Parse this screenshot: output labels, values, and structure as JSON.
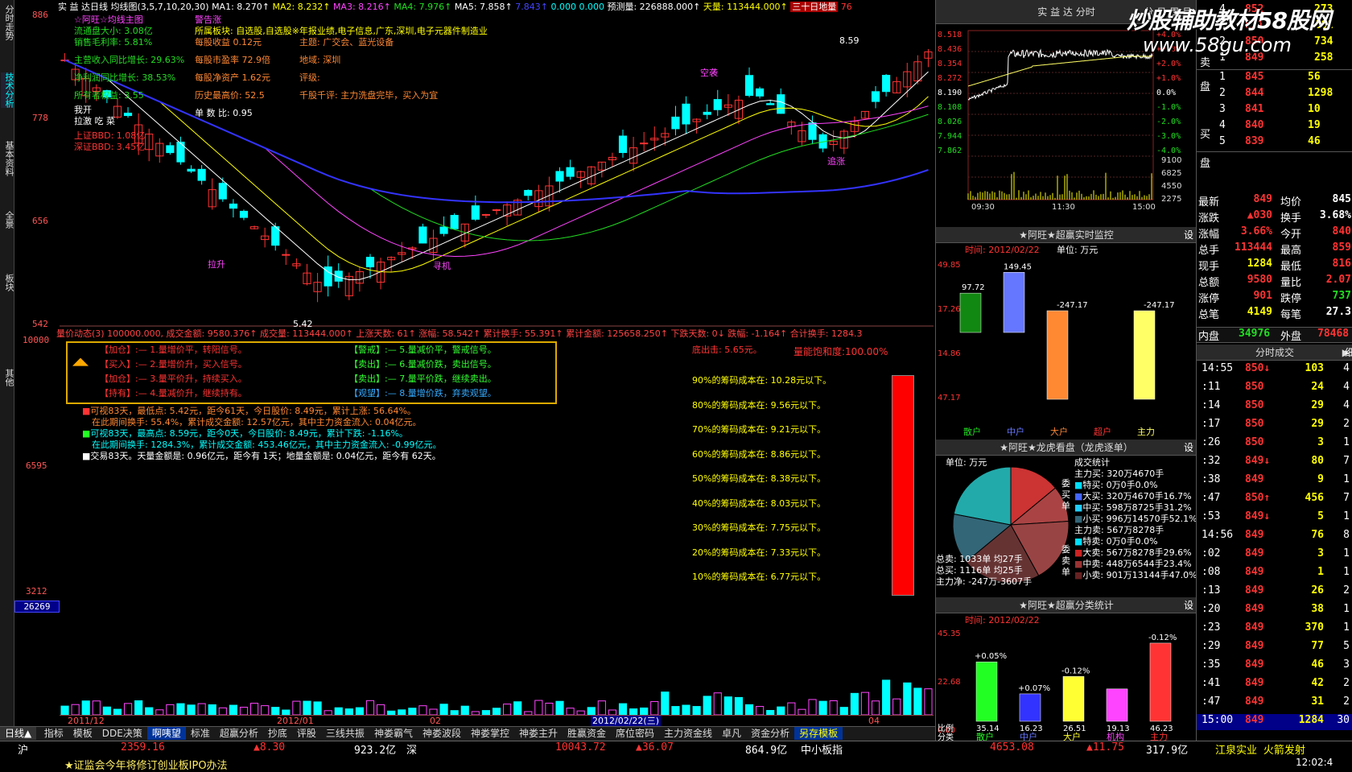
{
  "left_tabs": [
    "分时走势",
    "技术分析",
    "基本资料",
    "全景",
    "板块",
    "其他"
  ],
  "header": {
    "title": "实 益 达日线",
    "ma_label": "均线图(3,5,7,10,20,30)",
    "ma1": "MA1: 8.270↑",
    "ma2": "MA2: 8.232↑",
    "ma3": "MA3: 8.216↑",
    "ma4": "MA4: 7.976↑",
    "ma5": "MA5: 7.858↑",
    "ma6": "7.843↑",
    "v1": "0.000",
    "v2": "0.000",
    "forecast": "预测量: 226888.000↑",
    "vol": "天量: 113444.000↑",
    "thirty": "三十日地量",
    "last": "76"
  },
  "price_axis": [
    "886",
    "778",
    "656",
    "542"
  ],
  "chip_axis": [
    "10000",
    "6595",
    "3212"
  ],
  "vol_axis_box": "26269",
  "info_left": [
    "☆阿旺☆均线主图",
    "流通盘大小: 3.08亿",
    "销售毛利率: 5.81%",
    "主营收入同比增长: 29.63%",
    "净利润同比增长: 38.53%",
    "所有者权益: 3.55",
    "我开",
    "拉激 吃 菜",
    "上证BBD: 1.08亿",
    "深证BBD: 3.45亿"
  ],
  "info_right1": [
    "警告涨",
    "所属板块: 自选股,自选股※年报业绩,电子信息,广东,深圳,电子元器件制造业",
    "每股收益 0.12元",
    "每股市盈率 72.9倍",
    "每股净资产 1.62元",
    "历史最高价: 52.5",
    "单 数 比: 0.95"
  ],
  "info_right2": [
    "主题: 广交会、蓝光设备",
    "地域: 深圳",
    "评级:",
    "千股千评: 主力洗盘完毕，买入为宜"
  ],
  "chart_labels": {
    "peak": "8.59",
    "low": "5.42",
    "xi": "吸",
    "lakai": "拉升",
    "xunji": "寻机",
    "kongtou": "空袭",
    "zhuizhang": "追涨"
  },
  "status_line": "量价动态(3) 100000.000, 成交金额: 9580.376↑ 成交量: 113444.000↑ 上涨天数: 61↑ 涨幅: 58.542↑ 累计换手: 55.391↑ 累计金额: 125658.250↑ 下跌天数: 0↓ 跌幅: -1.164↑ 合计换手: 1284.3",
  "signals": [
    "【加仓】:— 1.量增价平，转阳信号。",
    "【警戒】:— 5.量减价平，警戒信号。",
    "【买入】:— 2.量增价升，买入信号。",
    "【卖出】:— 6.量减价跌，卖出信号。",
    "【加仓】:— 3.量平价升，持续买入。",
    "【卖出】:— 7.量平价跌，继续卖出。",
    "【持有】:— 4.量减价升，继续持有。",
    "【观望】:— 8.量增价跌，弃卖观望。"
  ],
  "stats_lines": [
    "可视83天，最低点: 5.42元，距今61天，今日股价: 8.49元，累计上涨: 56.64%。",
    "在此期间换手: 55.4%，累计成交金额: 12.57亿元，其中主力资金流入: 0.04亿元。",
    "可视83天，最高点: 8.59元，距今0天，今日股价: 8.49元，累计下跌: -1.16%。",
    "在此期间换手: 1284.3%，累计成交金额: 453.46亿元，其中主力资金流入: -0.99亿元。",
    "交易83天。天量金额是: 0.96亿元，距今有 1天；地量金额是: 0.04亿元，距今有 62天。"
  ],
  "chip": {
    "profit": "底出击: 5.65元。",
    "saturation": "量能饱和度:100.00%",
    "rows": [
      "90%的筹码成本在: 10.28元以下。",
      "80%的筹码成本在: 9.56元以下。",
      "70%的筹码成本在: 9.21元以下。",
      "60%的筹码成本在: 8.86元以下。",
      "50%的筹码成本在: 8.38元以下。",
      "40%的筹码成本在: 8.03元以下。",
      "30%的筹码成本在: 7.75元以下。",
      "20%的筹码成本在: 7.33元以下。",
      "10%的筹码成本在: 6.77元以下。"
    ],
    "saturation_value": 1.0
  },
  "date_axis": [
    "2011/12",
    "2012/01",
    "02",
    "2012/02/22(三)",
    "04"
  ],
  "bottom_tabs": [
    "指标",
    "模板",
    "DDE决策",
    "啊咦望",
    "标准",
    "超赢分析",
    "抄底",
    "评股",
    "三线共振",
    "神娄霸气",
    "神娄波段",
    "神娄掌控",
    "神娄主升",
    "胜赢资金",
    "席位密码",
    "主力资金线",
    "卓凡",
    "资金分析",
    "另存模板"
  ],
  "bottom_left": "日线▲",
  "ticker": [
    {
      "label": "沪",
      "value": "2359.16",
      "change": "▲8.30",
      "amount": "923.2亿"
    },
    {
      "label": "深",
      "value": "10043.72",
      "change": "▲36.07",
      "amount": "864.9亿"
    },
    {
      "label": "中小板指",
      "value": "4653.08",
      "change": "▲11.75",
      "amount": "317.9亿"
    }
  ],
  "ticker_news": "★证监会今年将修订创业板IPO办法",
  "ticker_stock": "江泉实业  火箭发射",
  "ticker_time": "12:02:4",
  "mini": {
    "title": "实 益 达 分时",
    "tabs": [
      "分",
      "日",
      "周",
      "月"
    ],
    "prices": [
      "8.518",
      "8.436",
      "8.354",
      "8.272",
      "8.190",
      "8.108",
      "8.026",
      "7.944",
      "7.862"
    ],
    "pcts": [
      "+4.0%",
      "+3.0%",
      "+2.0%",
      "+1.0%",
      "0.0%",
      "-1.0%",
      "-2.0%",
      "-3.0%",
      "-4.0%"
    ],
    "vols": [
      "9100",
      "6825",
      "4550",
      "2275"
    ],
    "times": [
      "09:30",
      "11:30",
      "15:00"
    ]
  },
  "panel1": {
    "title": "★阿旺★超赢实时监控",
    "date": "时间: 2012/02/22",
    "unit": "单位: 万元",
    "values": [
      "97.72",
      "149.45",
      "-247.17",
      "-247.17"
    ],
    "axis": [
      "49.85",
      "17.26",
      "14.86",
      "47.17"
    ],
    "cats": [
      "散户",
      "中户",
      "大户",
      "超户",
      "主力"
    ],
    "bars": [
      97.72,
      149.45,
      -247.17,
      0,
      -247.17
    ]
  },
  "panel2": {
    "title": "★阿旺★龙虎看盘（龙虎逐单）",
    "unit": "单位: 万元",
    "stats_title": "成交统计",
    "buy": [
      "主力买: 320万4670手",
      "特买: 0万0手0.0%",
      "大买: 320万4670手16.7%",
      "中买: 598万8725手31.2%",
      "小买: 996万14570手52.1%"
    ],
    "sell": [
      "主力卖: 567万8278手",
      "特卖: 0万0手0.0%",
      "大卖: 567万8278手29.6%",
      "中卖: 448万6544手23.4%",
      "小卖: 901万13144手47.0%"
    ],
    "left": [
      "总卖: 1033单 均27手",
      "总买: 1116单 均25手",
      "主力净: -247万-3607手"
    ],
    "side_buy": "委买单",
    "side_sell": "委卖单",
    "slices": [
      16.7,
      31.2,
      52.1,
      29.6,
      23.4,
      47.0
    ]
  },
  "panel3": {
    "title": "★阿旺★超赢分类统计",
    "date": "时间: 2012/02/22",
    "axis": [
      "45.35",
      "22.68",
      "0.00"
    ],
    "labels": [
      "+0.05%",
      "+0.07%",
      "-0.12%",
      "",
      "-0.12%"
    ],
    "bottoms": [
      "35.14",
      "16.23",
      "26.51",
      "19.13",
      "46.23"
    ],
    "cats": [
      "散户",
      "中户",
      "大户",
      "机构",
      "主力"
    ],
    "bars": [
      35.14,
      16.23,
      26.51,
      19.13,
      46.23
    ],
    "side": [
      "比例",
      "分类"
    ]
  },
  "order": {
    "sell": [
      {
        "n": "4",
        "p": "852",
        "v": "273"
      },
      {
        "n": "3",
        "p": "851",
        "v": "261"
      },
      {
        "n": "2",
        "p": "850",
        "v": "734"
      },
      {
        "n": "1",
        "p": "849",
        "v": "258"
      }
    ],
    "buy": [
      {
        "n": "1",
        "p": "845",
        "v": "56"
      },
      {
        "n": "2",
        "p": "844",
        "v": "1298"
      },
      {
        "n": "3",
        "p": "841",
        "v": "10"
      },
      {
        "n": "4",
        "p": "840",
        "v": "19"
      },
      {
        "n": "5",
        "p": "839",
        "v": "46"
      }
    ],
    "side_sell": [
      "卖",
      "盘"
    ],
    "side_buy": [
      "买",
      "盘"
    ]
  },
  "quote": [
    [
      "最新",
      "849",
      "均价",
      "845"
    ],
    [
      "涨跌",
      "▲030",
      "换手",
      "3.68%"
    ],
    [
      "涨幅",
      "3.66%",
      "今开",
      "840"
    ],
    [
      "总手",
      "113444",
      "最高",
      "859"
    ],
    [
      "现手",
      "1284",
      "最低",
      "816"
    ],
    [
      "总额",
      "9580",
      "量比",
      "2.07"
    ],
    [
      "涨停",
      "901",
      "跌停",
      "737"
    ],
    [
      "总笔",
      "4149",
      "每笔",
      "27.3"
    ]
  ],
  "inout": {
    "in_label": "内盘",
    "in": "34976",
    "out_label": "外盘",
    "out": "78468"
  },
  "ticks_title": "分时成交",
  "ticks_tab": "细",
  "ticks": [
    [
      "14:55",
      "850↓",
      "103",
      "4"
    ],
    [
      ":11",
      "850",
      "24",
      "4"
    ],
    [
      ":14",
      "850",
      "29",
      "4"
    ],
    [
      ":17",
      "850",
      "29",
      "2"
    ],
    [
      ":26",
      "850",
      "3",
      "1"
    ],
    [
      ":32",
      "849↓",
      "80",
      "7"
    ],
    [
      ":38",
      "849",
      "9",
      "1"
    ],
    [
      ":47",
      "850↑",
      "456",
      "7"
    ],
    [
      ":53",
      "849↓",
      "5",
      "1"
    ],
    [
      "14:56",
      "849",
      "76",
      "8"
    ],
    [
      ":02",
      "849",
      "3",
      "1"
    ],
    [
      ":08",
      "849",
      "1",
      "1"
    ],
    [
      ":13",
      "849",
      "26",
      "2"
    ],
    [
      ":20",
      "849",
      "38",
      "1"
    ],
    [
      ":23",
      "849",
      "370",
      "1"
    ],
    [
      ":29",
      "849",
      "77",
      "5"
    ],
    [
      ":35",
      "849",
      "46",
      "3"
    ],
    [
      ":41",
      "849",
      "42",
      "2"
    ],
    [
      ":47",
      "849",
      "31",
      "2"
    ],
    [
      "15:00",
      "849",
      "1284",
      "30"
    ]
  ],
  "watermark": [
    "炒股辅助教材58股网",
    "www.58gu.com"
  ]
}
